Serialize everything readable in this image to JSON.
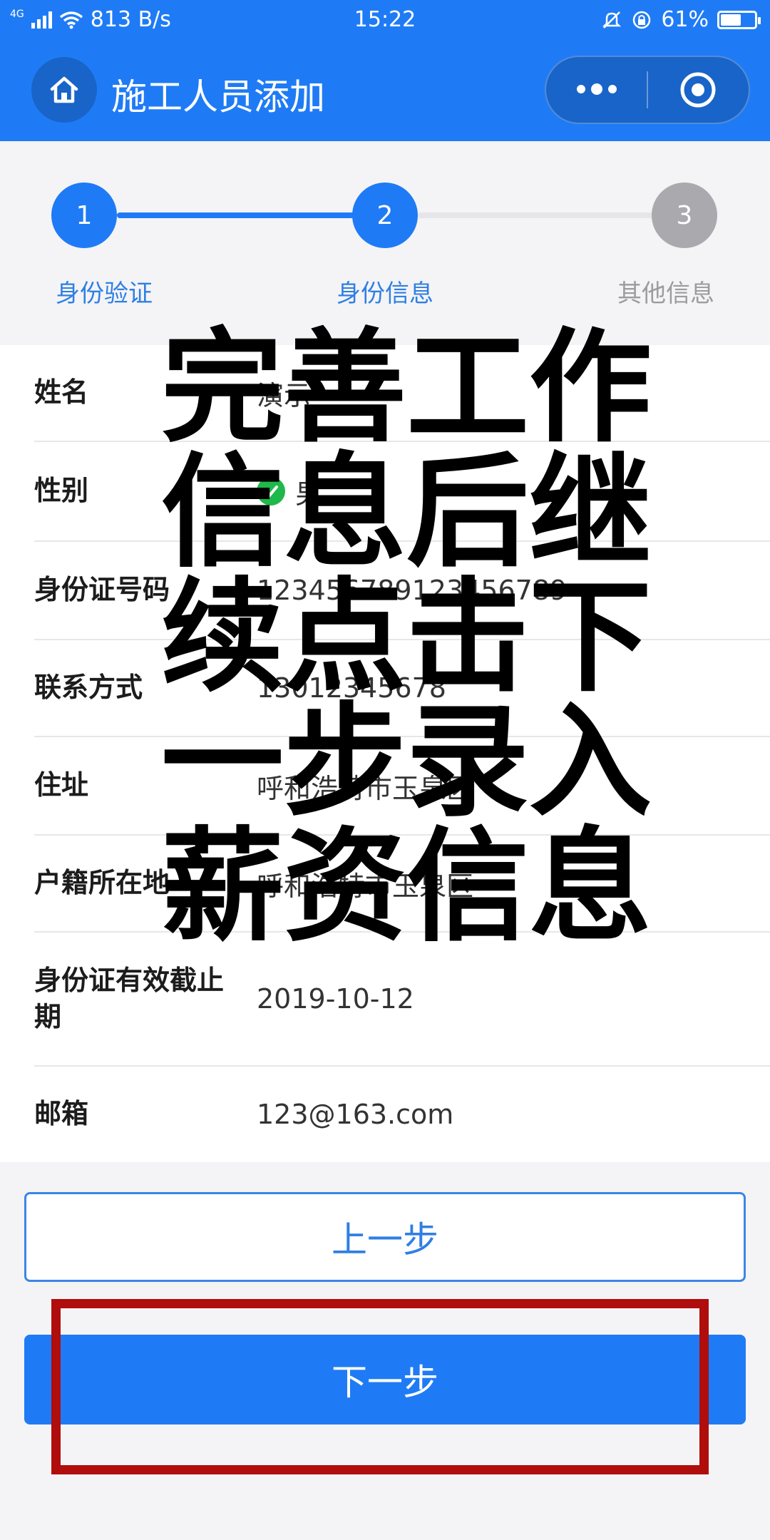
{
  "status_bar": {
    "network": "4G",
    "speed": "813 B/s",
    "time": "15:22",
    "battery": "61%",
    "battery_level": 0.61
  },
  "header": {
    "title": "施工人员添加",
    "home_icon": "home-icon",
    "more_icon": "more-dots-icon",
    "close_icon": "target-close-icon",
    "color": "#1f7bf5"
  },
  "stepper": {
    "steps": [
      {
        "number": "1",
        "label": "身份验证",
        "state": "done"
      },
      {
        "number": "2",
        "label": "身份信息",
        "state": "current"
      },
      {
        "number": "3",
        "label": "其他信息",
        "state": "pending"
      }
    ],
    "active_color": "#1f7bf5",
    "inactive_color": "#a9a9ae"
  },
  "form": {
    "rows": [
      {
        "label": "姓名",
        "value": "演示"
      },
      {
        "label": "性别",
        "value": "男"
      },
      {
        "label": "身份证号码",
        "value": "123456789123456789"
      },
      {
        "label": "联系方式",
        "value": "13012345678"
      },
      {
        "label": "住址",
        "value": "呼和浩特市玉泉区"
      },
      {
        "label": "户籍所在地",
        "value": "呼和浩特市玉泉区"
      },
      {
        "label": "身份证有效截止期",
        "value": "2019-10-12"
      },
      {
        "label": "邮箱",
        "value": "123@163.com"
      }
    ]
  },
  "buttons": {
    "prev_label": "上一步",
    "next_label": "下一步"
  },
  "overlay": {
    "caption": "完善工作信息后继续点击下一步录入薪资信息",
    "highlight_color": "#b00d0d"
  }
}
